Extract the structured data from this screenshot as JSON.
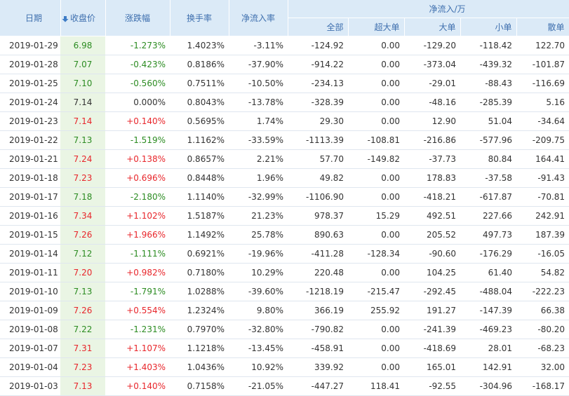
{
  "header": {
    "date": "日期",
    "close": "收盘价",
    "change": "涨跌幅",
    "turnover": "换手率",
    "net_inflow_rate": "净流入率",
    "net_inflow_group": "净流入/万",
    "all": "全部",
    "super_large": "超大单",
    "large": "大单",
    "small": "小单",
    "retail": "散单",
    "sort_icon": "arrow-down-icon"
  },
  "colors": {
    "up": "#e8262b",
    "down": "#2c8c22",
    "header_bg": "#dbeaf7",
    "close_bg": "#eaf5e4"
  },
  "rows": [
    {
      "date": "2019-01-29",
      "close": "6.98",
      "change": "-1.273%",
      "turnover": "1.4023%",
      "rate": "-3.11%",
      "all": "-124.92",
      "super": "0.00",
      "large": "-129.20",
      "small": "-118.42",
      "retail": "122.70",
      "trend": "down"
    },
    {
      "date": "2019-01-28",
      "close": "7.07",
      "change": "-0.423%",
      "turnover": "0.8186%",
      "rate": "-37.90%",
      "all": "-914.22",
      "super": "0.00",
      "large": "-373.04",
      "small": "-439.32",
      "retail": "-101.87",
      "trend": "down"
    },
    {
      "date": "2019-01-25",
      "close": "7.10",
      "change": "-0.560%",
      "turnover": "0.7511%",
      "rate": "-10.50%",
      "all": "-234.13",
      "super": "0.00",
      "large": "-29.01",
      "small": "-88.43",
      "retail": "-116.69",
      "trend": "down"
    },
    {
      "date": "2019-01-24",
      "close": "7.14",
      "change": "0.000%",
      "turnover": "0.8043%",
      "rate": "-13.78%",
      "all": "-328.39",
      "super": "0.00",
      "large": "-48.16",
      "small": "-285.39",
      "retail": "5.16",
      "trend": "flat"
    },
    {
      "date": "2019-01-23",
      "close": "7.14",
      "change": "+0.140%",
      "turnover": "0.5695%",
      "rate": "1.74%",
      "all": "29.30",
      "super": "0.00",
      "large": "12.90",
      "small": "51.04",
      "retail": "-34.64",
      "trend": "up"
    },
    {
      "date": "2019-01-22",
      "close": "7.13",
      "change": "-1.519%",
      "turnover": "1.1162%",
      "rate": "-33.59%",
      "all": "-1113.39",
      "super": "-108.81",
      "large": "-216.86",
      "small": "-577.96",
      "retail": "-209.75",
      "trend": "down"
    },
    {
      "date": "2019-01-21",
      "close": "7.24",
      "change": "+0.138%",
      "turnover": "0.8657%",
      "rate": "2.21%",
      "all": "57.70",
      "super": "-149.82",
      "large": "-37.73",
      "small": "80.84",
      "retail": "164.41",
      "trend": "up"
    },
    {
      "date": "2019-01-18",
      "close": "7.23",
      "change": "+0.696%",
      "turnover": "0.8448%",
      "rate": "1.96%",
      "all": "49.82",
      "super": "0.00",
      "large": "178.83",
      "small": "-37.58",
      "retail": "-91.43",
      "trend": "up"
    },
    {
      "date": "2019-01-17",
      "close": "7.18",
      "change": "-2.180%",
      "turnover": "1.1140%",
      "rate": "-32.99%",
      "all": "-1106.90",
      "super": "0.00",
      "large": "-418.21",
      "small": "-617.87",
      "retail": "-70.81",
      "trend": "down"
    },
    {
      "date": "2019-01-16",
      "close": "7.34",
      "change": "+1.102%",
      "turnover": "1.5187%",
      "rate": "21.23%",
      "all": "978.37",
      "super": "15.29",
      "large": "492.51",
      "small": "227.66",
      "retail": "242.91",
      "trend": "up"
    },
    {
      "date": "2019-01-15",
      "close": "7.26",
      "change": "+1.966%",
      "turnover": "1.1492%",
      "rate": "25.78%",
      "all": "890.63",
      "super": "0.00",
      "large": "205.52",
      "small": "497.73",
      "retail": "187.39",
      "trend": "up"
    },
    {
      "date": "2019-01-14",
      "close": "7.12",
      "change": "-1.111%",
      "turnover": "0.6921%",
      "rate": "-19.96%",
      "all": "-411.28",
      "super": "-128.34",
      "large": "-90.60",
      "small": "-176.29",
      "retail": "-16.05",
      "trend": "down"
    },
    {
      "date": "2019-01-11",
      "close": "7.20",
      "change": "+0.982%",
      "turnover": "0.7180%",
      "rate": "10.29%",
      "all": "220.48",
      "super": "0.00",
      "large": "104.25",
      "small": "61.40",
      "retail": "54.82",
      "trend": "up"
    },
    {
      "date": "2019-01-10",
      "close": "7.13",
      "change": "-1.791%",
      "turnover": "1.0288%",
      "rate": "-39.60%",
      "all": "-1218.19",
      "super": "-215.47",
      "large": "-292.45",
      "small": "-488.04",
      "retail": "-222.23",
      "trend": "down"
    },
    {
      "date": "2019-01-09",
      "close": "7.26",
      "change": "+0.554%",
      "turnover": "1.2324%",
      "rate": "9.80%",
      "all": "366.19",
      "super": "255.92",
      "large": "191.27",
      "small": "-147.39",
      "retail": "66.38",
      "trend": "up"
    },
    {
      "date": "2019-01-08",
      "close": "7.22",
      "change": "-1.231%",
      "turnover": "0.7970%",
      "rate": "-32.80%",
      "all": "-790.82",
      "super": "0.00",
      "large": "-241.39",
      "small": "-469.23",
      "retail": "-80.20",
      "trend": "down"
    },
    {
      "date": "2019-01-07",
      "close": "7.31",
      "change": "+1.107%",
      "turnover": "1.1218%",
      "rate": "-13.45%",
      "all": "-458.91",
      "super": "0.00",
      "large": "-418.69",
      "small": "28.01",
      "retail": "-68.23",
      "trend": "up"
    },
    {
      "date": "2019-01-04",
      "close": "7.23",
      "change": "+1.403%",
      "turnover": "1.0436%",
      "rate": "10.92%",
      "all": "339.92",
      "super": "0.00",
      "large": "165.01",
      "small": "142.91",
      "retail": "32.00",
      "trend": "up"
    },
    {
      "date": "2019-01-03",
      "close": "7.13",
      "change": "+0.140%",
      "turnover": "0.7158%",
      "rate": "-21.05%",
      "all": "-447.27",
      "super": "118.41",
      "large": "-92.55",
      "small": "-304.96",
      "retail": "-168.17",
      "trend": "up"
    }
  ]
}
